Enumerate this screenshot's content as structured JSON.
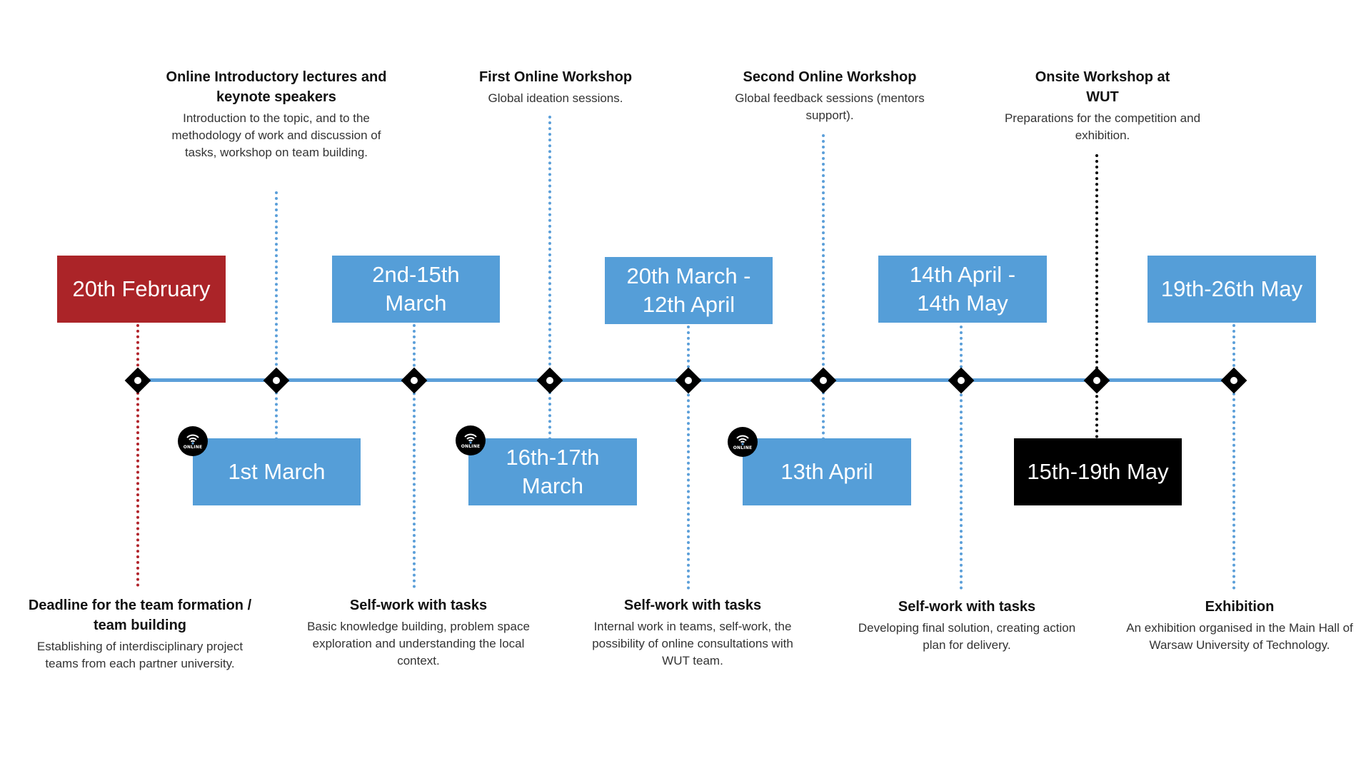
{
  "colors": {
    "timeline": "#5b9fd9",
    "accent_red": "#ab2428",
    "box_blue": "#559ed8",
    "box_black": "#000000"
  },
  "online_badge": {
    "icon": "wifi-icon",
    "label": "ONLINE"
  },
  "top_labels": [
    {
      "title": "Online Introductory lectures and keynote speakers",
      "description": "Introduction to the topic, and to the methodology of work and discussion of tasks, workshop on team building."
    },
    {
      "title": "First Online Workshop",
      "description": "Global ideation sessions."
    },
    {
      "title": "Second Online Workshop",
      "description": "Global feedback sessions (mentors support)."
    },
    {
      "title": "Onsite Workshop at WUT",
      "description": "Preparations for the competition and exhibition."
    }
  ],
  "bottom_labels": [
    {
      "title": "Deadline for the team formation / team building",
      "description": "Establishing of interdisciplinary project teams from each partner university."
    },
    {
      "title": "Self-work with tasks",
      "description": "Basic knowledge building, problem space exploration and understanding the local context."
    },
    {
      "title": "Self-work with tasks",
      "description": "Internal work in teams, self-work, the possibility of online consultations with WUT team."
    },
    {
      "title": "Self-work with tasks",
      "description": "Developing final solution, creating action plan for delivery."
    },
    {
      "title": "Exhibition",
      "description": "An exhibition organised in the Main Hall of Warsaw University of Technology."
    }
  ],
  "date_boxes": {
    "feb20": "20th February",
    "mar1": "1st March",
    "mar2_15": "2nd-15th March",
    "mar16_17": "16th-17th March",
    "mar20_apr12": "20th March - 12th April",
    "apr13": "13th April",
    "apr14_may14": "14th April - 14th May",
    "may15_19": "15th-19th May",
    "may19_26": "19th-26th May"
  }
}
